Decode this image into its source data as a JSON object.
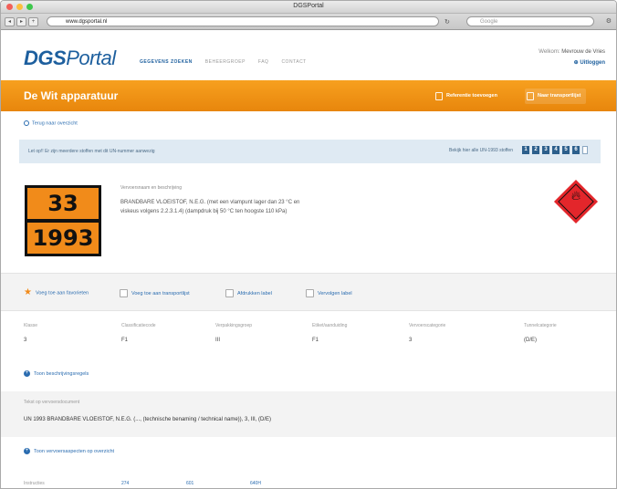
{
  "browser": {
    "window_title": "DGSPortal",
    "url": "www.dgsportal.nl",
    "search_placeholder": "Google"
  },
  "header": {
    "logo_a": "DGS",
    "logo_b": "Portal",
    "nav": [
      "GEGEVENS ZOEKEN",
      "BEHEERGROEP",
      "FAQ",
      "CONTACT"
    ],
    "user_prefix": "Welkom:",
    "user_name": "Mevrouw de Vries",
    "logout": "Uitloggen"
  },
  "page": {
    "title": "De Wit apparatuur",
    "btn_reference": "Referentie toevoegen",
    "btn_transport": "Naar transportlijst",
    "back": "Terug naar overzicht"
  },
  "infobar": {
    "text": "Let op!! Er zijn meerdere stoffen met dit UN-nummer aanwezig",
    "right_label": "Bekijk hier alle UN-1993 stoffen",
    "digits": [
      "1",
      "2",
      "3",
      "4",
      "5",
      "6"
    ]
  },
  "substance": {
    "kemler": "33",
    "un": "1993",
    "desc_label": "Vervoersnaam en beschrijving",
    "description": "BRANDBARE VLOEISTOF, N.E.G. (met een vlampunt lager dan 23 °C en viskeus volgens 2.2.3.1.4) (dampdruk bij 50 °C ten hoogste 110 kPa)"
  },
  "actions": [
    "Voeg toe aan favorieten",
    "Voeg toe aan transportlijst",
    "Afdrukken label",
    "Vervolgen label"
  ],
  "properties": [
    {
      "label": "Klasse",
      "value": "3"
    },
    {
      "label": "Classificatiecode",
      "value": "F1"
    },
    {
      "label": "Verpakkingsgroep",
      "value": "III"
    },
    {
      "label": "Etiket/aanduiding",
      "value": "F1"
    },
    {
      "label": "Vervoerscategorie",
      "value": "3"
    },
    {
      "label": "Tunnelcategorie",
      "value": "(D/E)"
    }
  ],
  "more_props": "Toon beschrijvingsregels",
  "transport_doc": {
    "label": "Tekst op vervoersdocument",
    "value": "UN 1993 BRANDBARE VLOEISTOF, N.E.G. (..., (technische benaming / technical name)), 3, III, (D/E)"
  },
  "more_transport": "Toon vervoersaspecten op overzicht",
  "bottom": {
    "label": "Instructies",
    "links": [
      "274",
      "601",
      "640H"
    ]
  },
  "colors": {
    "brand_blue": "#1d5f9e",
    "orange": "#f18b1a",
    "hazard_red": "#e3262b"
  }
}
